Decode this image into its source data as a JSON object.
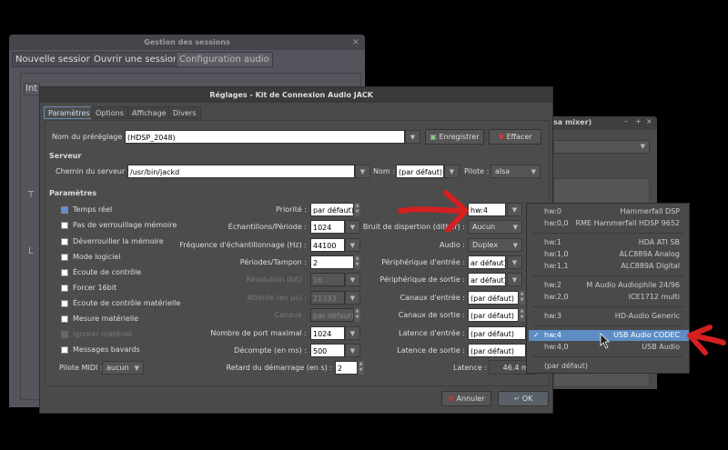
{
  "session_window": {
    "title": "Gestion des sessions",
    "close": "×",
    "tabs": [
      "Nouvelle session",
      "Ouvrir une session",
      "Configuration audio"
    ],
    "inner_tab_partial": "Int",
    "left_letters": [
      "T",
      "L"
    ]
  },
  "mixer_window": {
    "title_partial": "sa mixer)",
    "controls": [
      "–",
      "+",
      "×"
    ]
  },
  "dialog": {
    "title": "Réglages - Kit de Connexion Audio JACK",
    "tabs": [
      "Paramètres",
      "Options",
      "Affichage",
      "Divers"
    ],
    "preset_label": "Nom du préréglage :",
    "preset_value": "(HDSP_2048)",
    "save": "Enregistrer",
    "clear": "Effacer",
    "server_section": "Serveur",
    "server_path_label": "Chemin du serveur :",
    "server_path": "/usr/bin/jackd",
    "name_label": "Nom :",
    "name_value": "(par défaut)",
    "driver_label": "Pilote :",
    "driver_value": "alsa",
    "params_section": "Paramètres",
    "checkboxes": [
      {
        "label": "Temps réel",
        "checked": true,
        "disabled": false
      },
      {
        "label": "Pas de verrouillage mémoire",
        "checked": false,
        "disabled": false
      },
      {
        "label": "Déverrouiller la mémoire",
        "checked": false,
        "disabled": false
      },
      {
        "label": "Mode logiciel",
        "checked": false,
        "disabled": false
      },
      {
        "label": "Écoute de contrôle",
        "checked": false,
        "disabled": false
      },
      {
        "label": "Forcer 16bit",
        "checked": false,
        "disabled": false
      },
      {
        "label": "Écoute de contrôle matérielle",
        "checked": false,
        "disabled": false
      },
      {
        "label": "Mesure matérielle",
        "checked": false,
        "disabled": false
      },
      {
        "label": "Ignorer matériel",
        "checked": false,
        "disabled": true
      },
      {
        "label": "Messages bavards",
        "checked": false,
        "disabled": false
      }
    ],
    "midi_label": "Pilote MIDI :",
    "midi_value": "aucun",
    "mid_fields": [
      {
        "label": "Priorité :",
        "value": "par défaut)",
        "kind": "spin",
        "disabled": false
      },
      {
        "label": "Échantillons/Période :",
        "value": "1024",
        "kind": "combo",
        "disabled": false
      },
      {
        "label": "Fréquence d'échantillonnage (Hz) :",
        "value": "44100",
        "kind": "combo",
        "disabled": false
      },
      {
        "label": "Périodes/Tampon :",
        "value": "2",
        "kind": "spin",
        "disabled": false
      },
      {
        "label": "Résolution (bit) :",
        "value": "16",
        "kind": "combo",
        "disabled": true
      },
      {
        "label": "Attente (en µs) :",
        "value": "21333",
        "kind": "combo",
        "disabled": true
      },
      {
        "label": "Canaux :",
        "value": "par défaut)",
        "kind": "spin",
        "disabled": true
      },
      {
        "label": "Nombre de port maximal :",
        "value": "1024",
        "kind": "combo",
        "disabled": false
      },
      {
        "label": "Décompte (en ms) :",
        "value": "500",
        "kind": "combo",
        "disabled": false
      }
    ],
    "startup_delay_label": "Retard du démarrage (en s) :",
    "startup_delay": "2",
    "right_fields": [
      {
        "label": "",
        "value": "hw:4",
        "kind": "combo"
      },
      {
        "label": "Bruit de dispertion (dither) :",
        "value": "Aucun",
        "kind": "select"
      },
      {
        "label": "Audio :",
        "value": "Duplex",
        "kind": "select"
      },
      {
        "label": "Périphérique d'entrée :",
        "value": "ar défaut)",
        "kind": "combo"
      },
      {
        "label": "Périphérique de sortie :",
        "value": "ar défaut)",
        "kind": "combo"
      },
      {
        "label": "Canaux d'entrée :",
        "value": "(par défaut)",
        "kind": "spin"
      },
      {
        "label": "Canaux de sortie :",
        "value": "(par défaut)",
        "kind": "spin"
      },
      {
        "label": "Latence d'entrée :",
        "value": "(par défaut)",
        "kind": "spin"
      },
      {
        "label": "Latence de sortie :",
        "value": "(par défaut)",
        "kind": "spin"
      }
    ],
    "latency_label": "Latence :",
    "latency_value": "46.4 ms",
    "cancel": "Annuler",
    "ok": "OK"
  },
  "device_popup": {
    "items": [
      {
        "key": "hw:0",
        "name": "Hammerfall DSP",
        "group": 0
      },
      {
        "key": "hw:0,0",
        "name": "RME Hammerfall HDSP 9652",
        "group": 0
      },
      {
        "key": "hw:1",
        "name": "HDA ATI SB",
        "group": 1
      },
      {
        "key": "hw:1,0",
        "name": "ALC889A Analog",
        "group": 1
      },
      {
        "key": "hw:1,1",
        "name": "ALC889A Digital",
        "group": 1
      },
      {
        "key": "hw:2",
        "name": "M Audio Audiophile 24/96",
        "group": 2
      },
      {
        "key": "hw:2,0",
        "name": "ICE1712 multi",
        "group": 2
      },
      {
        "key": "hw:3",
        "name": "HD-Audio Generic",
        "group": 3
      },
      {
        "key": "hw:4",
        "name": "USB Audio CODEC",
        "group": 4,
        "selected": true
      },
      {
        "key": "hw:4,0",
        "name": "USB Audio",
        "group": 4
      },
      {
        "key": "(par défaut)",
        "name": "",
        "group": 5
      }
    ],
    "check": "✓"
  },
  "colors": {
    "annotation_arrow": "#d42020",
    "selection": "#5d8dc4"
  }
}
